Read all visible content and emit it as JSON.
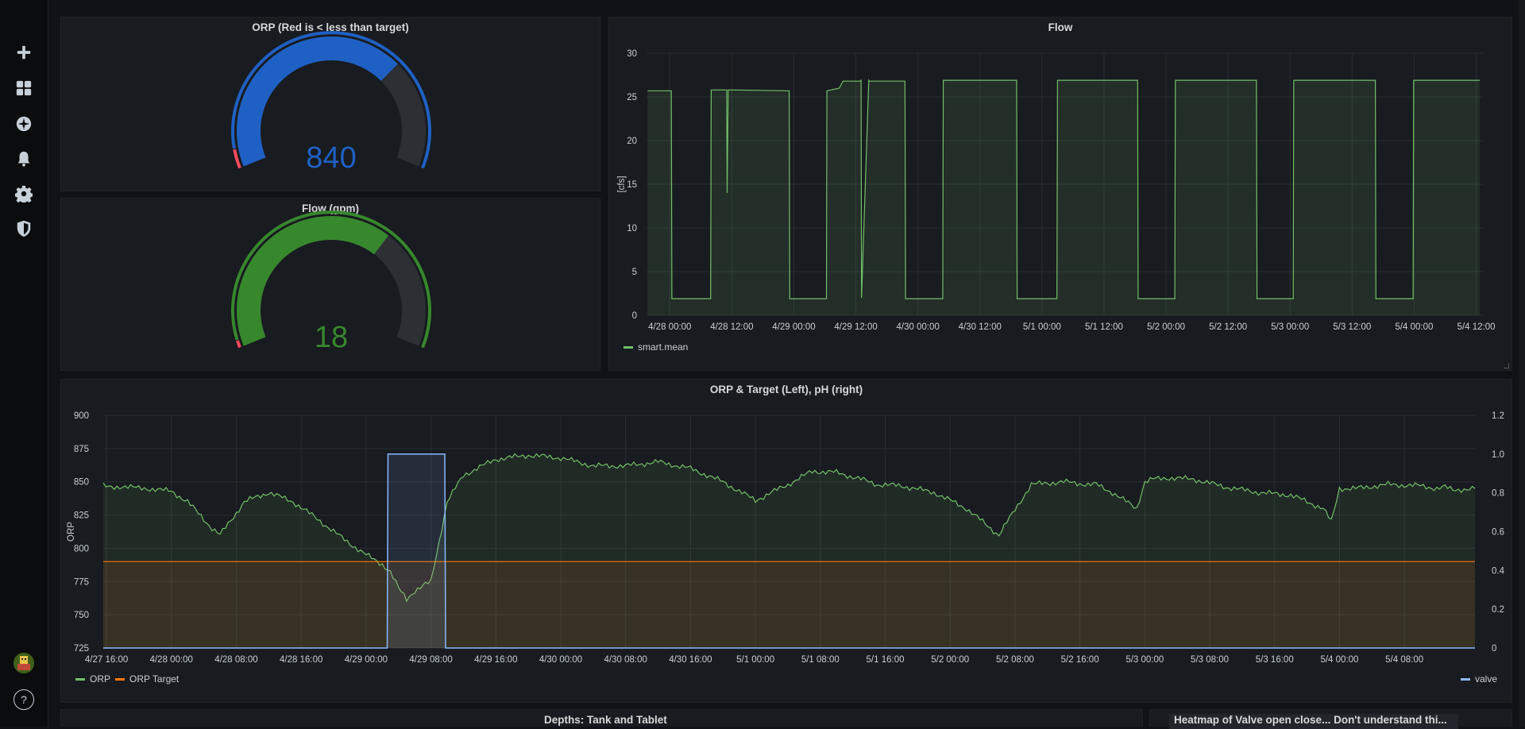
{
  "sidebar": {
    "items": [
      {
        "name": "create",
        "icon": "plus-icon"
      },
      {
        "name": "dashboards",
        "icon": "dashboard-grid-icon"
      },
      {
        "name": "explore",
        "icon": "compass-icon"
      },
      {
        "name": "alerting",
        "icon": "bell-icon"
      },
      {
        "name": "configuration",
        "icon": "gear-icon"
      },
      {
        "name": "server-admin",
        "icon": "shield-icon"
      }
    ],
    "help": "?"
  },
  "orp_gauge": {
    "title": "ORP (Red is < less than target)",
    "value": "840",
    "value_num": 840,
    "min": 700,
    "max": 900,
    "threshold": 710,
    "color": "#1f60c4",
    "threshold_color": "#f2495c"
  },
  "flow_gauge": {
    "title": "Flow (gpm)",
    "value": "18",
    "value_num": 18,
    "min": 0,
    "max": 27,
    "threshold": 0.5,
    "color": "#37872d",
    "threshold_color": "#f2495c"
  },
  "flow_chart": {
    "title": "Flow",
    "ylabel": "[cfs]",
    "legend": [
      {
        "name": "smart.mean",
        "color": "#73bf69"
      }
    ]
  },
  "orp_chart": {
    "title": "ORP & Target (Left), pH (right)",
    "ylabel": "ORP",
    "legend_left": [
      {
        "name": "ORP",
        "color": "#73bf69"
      },
      {
        "name": "ORP Target",
        "color": "#ff780a"
      }
    ],
    "legend_right": [
      {
        "name": "valve",
        "color": "#8ab8ff"
      }
    ]
  },
  "bottom": {
    "left_title": "Depths: Tank and Tablet",
    "right_title": "Heatmap of Valve open close... Don't understand thi..."
  },
  "chart_data": [
    {
      "type": "area",
      "title": "Flow",
      "ylabel": "[cfs]",
      "ylim": [
        0,
        30
      ],
      "yticks": [
        0,
        5,
        10,
        15,
        20,
        25,
        30
      ],
      "xticks": [
        "4/28 00:00",
        "4/28 12:00",
        "4/29 00:00",
        "4/29 12:00",
        "4/30 00:00",
        "4/30 12:00",
        "5/1 00:00",
        "5/1 12:00",
        "5/2 00:00",
        "5/2 12:00",
        "5/3 00:00",
        "5/3 12:00",
        "5/4 00:00",
        "5/4 12:00"
      ],
      "x_range_hours": [
        -4.5,
        157.3
      ],
      "grid": true,
      "legend_position": "bottom-left",
      "series": [
        {
          "name": "smart.mean",
          "color": "#73bf69",
          "x": [
            -4.3,
            0.3,
            0.4,
            7.9,
            8.0,
            11.0,
            11.1,
            11.3,
            11.4,
            23.1,
            23.2,
            30.3,
            30.4,
            32.8,
            33.5,
            36.8,
            37.0,
            37.1,
            38.5,
            38.6,
            45.5,
            45.6,
            52.8,
            52.9,
            67.1,
            67.2,
            74.9,
            75.0,
            90.5,
            90.6,
            97.7,
            97.8,
            113.5,
            113.6,
            120.6,
            120.7,
            136.5,
            136.6,
            143.8,
            143.9,
            156.7
          ],
          "y": [
            25.7,
            25.7,
            1.9,
            1.9,
            25.8,
            25.8,
            14.0,
            25.8,
            25.8,
            25.7,
            1.9,
            1.9,
            25.7,
            26.0,
            26.8,
            26.8,
            26.9,
            2.0,
            26.9,
            26.8,
            26.8,
            1.9,
            1.9,
            26.9,
            26.9,
            1.9,
            1.9,
            26.9,
            26.9,
            1.9,
            1.9,
            26.9,
            26.9,
            1.9,
            1.9,
            26.9,
            26.9,
            1.9,
            1.9,
            26.9,
            26.9
          ]
        }
      ]
    },
    {
      "type": "line",
      "title": "ORP & Target (Left), pH (right)",
      "ylabel": "ORP",
      "ylim": [
        725,
        900
      ],
      "yticks": [
        725,
        750,
        775,
        800,
        825,
        850,
        875,
        900
      ],
      "y2lim": [
        0,
        1.2
      ],
      "y2ticks": [
        0,
        0.2,
        0.4,
        0.6,
        0.8,
        1.0,
        1.2
      ],
      "xticks": [
        "4/27 16:00",
        "4/28 00:00",
        "4/28 08:00",
        "4/28 16:00",
        "4/29 00:00",
        "4/29 08:00",
        "4/29 16:00",
        "4/30 00:00",
        "4/30 08:00",
        "4/30 16:00",
        "5/1 00:00",
        "5/1 08:00",
        "5/1 16:00",
        "5/2 00:00",
        "5/2 08:00",
        "5/2 16:00",
        "5/3 00:00",
        "5/3 08:00",
        "5/3 16:00",
        "5/4 00:00",
        "5/4 08:00"
      ],
      "x_range_hours": [
        -8.4,
        160.7
      ],
      "grid": true,
      "legend_position": "bottom",
      "series": [
        {
          "name": "ORP",
          "axis": "left",
          "color": "#73bf69",
          "x": [
            -8.4,
            -3,
            0,
            2,
            4,
            5,
            6,
            9,
            12,
            15,
            18,
            21,
            24,
            26,
            27,
            28,
            29,
            30,
            32,
            34,
            36,
            40,
            44,
            48,
            52,
            56,
            60,
            64,
            68,
            72,
            76,
            79,
            82,
            85,
            87,
            90,
            94,
            98,
            102,
            106,
            110,
            113,
            114,
            116,
            119,
            120,
            121,
            123,
            126,
            130,
            134,
            138,
            142,
            143,
            144,
            146,
            150,
            154,
            156,
            157,
            158,
            160.7
          ],
          "y": [
            847,
            845,
            843,
            835,
            822,
            815,
            810,
            835,
            842,
            835,
            822,
            808,
            795,
            788,
            782,
            770,
            762,
            768,
            775,
            835,
            855,
            867,
            870,
            868,
            862,
            862,
            865,
            860,
            850,
            836,
            848,
            858,
            857,
            852,
            848,
            847,
            842,
            830,
            810,
            848,
            850,
            848,
            848,
            842,
            830,
            850,
            852,
            853,
            852,
            846,
            842,
            840,
            830,
            820,
            845,
            845,
            848,
            847,
            845,
            846,
            844,
            845
          ]
        },
        {
          "name": "ORP Target",
          "axis": "left",
          "color": "#ff780a",
          "x": [
            -8.4,
            160.7
          ],
          "y": [
            790,
            790
          ]
        },
        {
          "name": "valve",
          "axis": "right",
          "color": "#8ab8ff",
          "x": [
            -8.4,
            26.6,
            26.7,
            33.7,
            33.8,
            160.7
          ],
          "y": [
            0,
            0,
            1.0,
            1.0,
            0,
            0
          ]
        }
      ]
    }
  ]
}
